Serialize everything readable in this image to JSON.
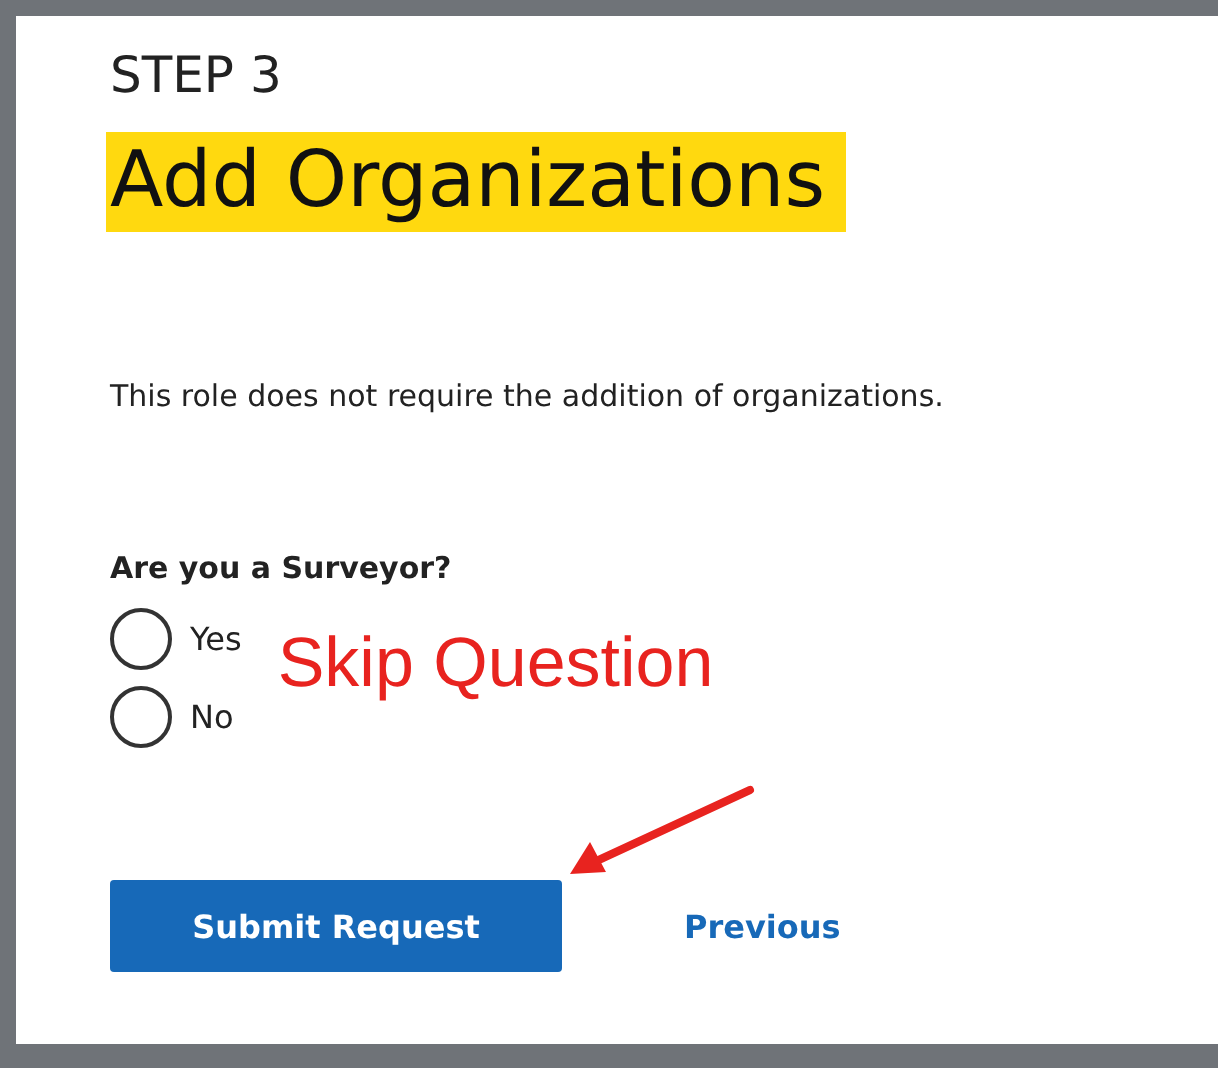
{
  "step_label": "STEP 3",
  "title": "Add Organizations",
  "description": "This role does not require the addition of organizations.",
  "question": {
    "label": "Are you a Surveyor?",
    "options": [
      {
        "label": "Yes",
        "selected": false
      },
      {
        "label": "No",
        "selected": false
      }
    ]
  },
  "annotation": {
    "text": "Skip Question"
  },
  "actions": [
    {
      "kind": "primary",
      "label": "Submit Request"
    },
    {
      "kind": "link",
      "label": "Previous"
    }
  ]
}
